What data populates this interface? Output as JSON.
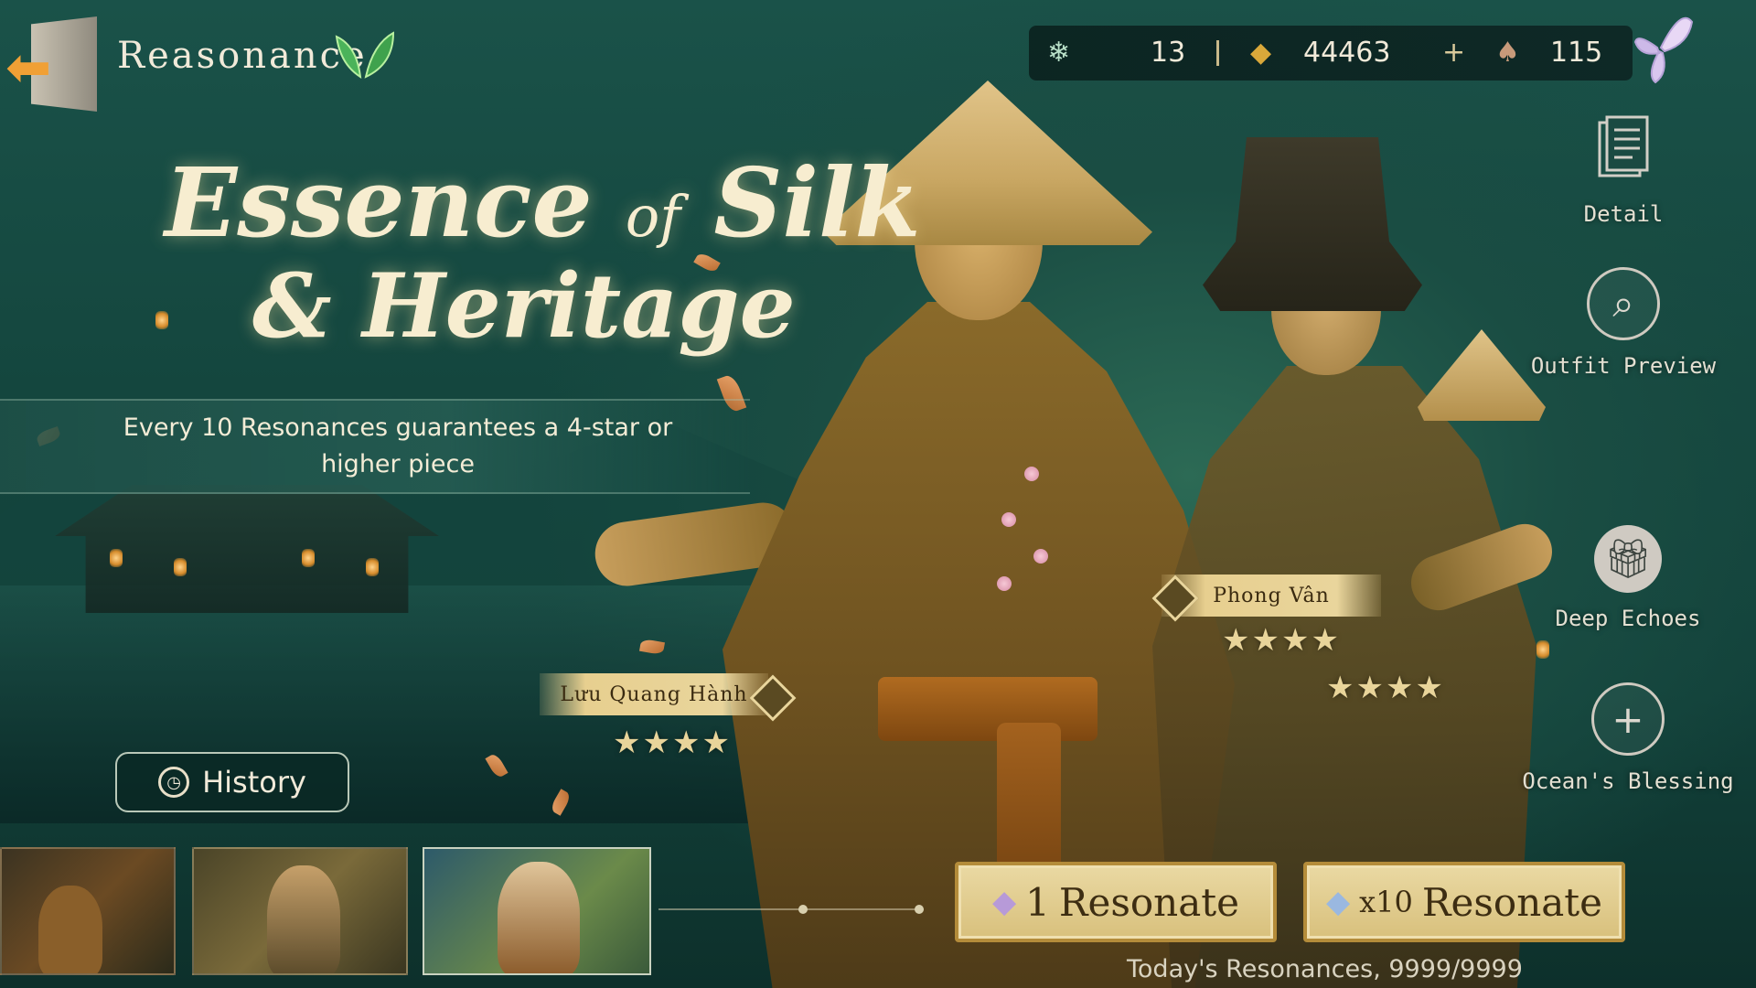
{
  "header": {
    "title": "Reasonance",
    "back_icon": "exit-door-icon",
    "logo_icon": "green-leaves-icon"
  },
  "currencies": [
    {
      "icon": "snowflake-crystal-icon",
      "value": "13"
    },
    {
      "icon": "gold-leaf-icon",
      "value": "44463"
    },
    {
      "icon": "plus-icon",
      "value": "+"
    },
    {
      "icon": "feather-shell-icon",
      "value": "115"
    }
  ],
  "banner": {
    "title_line1_a": "Essence",
    "title_of": "of",
    "title_line1_b": "Silk",
    "title_line2": "& Heritage",
    "guarantee": "Every 10 Resonances guarantees a 4-star or higher piece"
  },
  "side_menu": {
    "detail": "Detail",
    "outfit_preview": "Outfit Preview",
    "deep_echoes": "Deep Echoes",
    "oceans_blessing": "Ocean's Blessing"
  },
  "characters": [
    {
      "name": "Lưu Quang Hành",
      "stars": "★★★★"
    },
    {
      "name": "Phong Vân",
      "stars": "★★★★",
      "extra_stars": "★★★★"
    }
  ],
  "history": {
    "label": "History"
  },
  "actions": {
    "single": {
      "count": "1",
      "label": "Resonate"
    },
    "ten": {
      "count": "x10",
      "label": "Resonate"
    },
    "today": "Today's Resonances, 9999/9999"
  },
  "colors": {
    "background": "#14463e",
    "gold_button": "#e2cd91",
    "accent_orange": "#f0a035"
  }
}
